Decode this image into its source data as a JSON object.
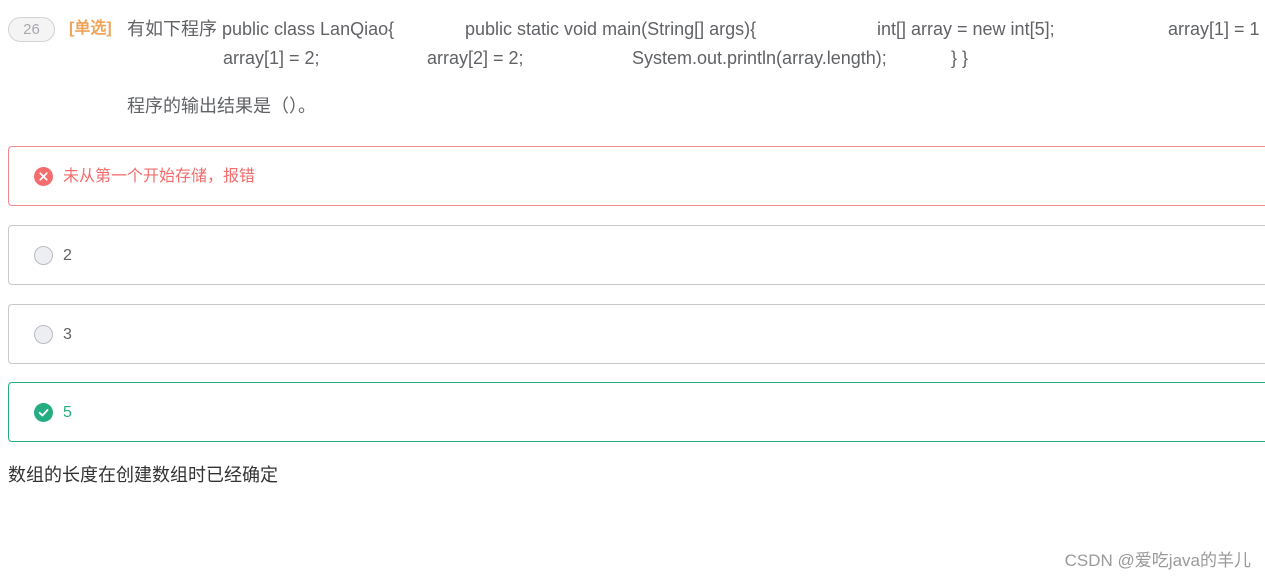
{
  "question": {
    "number": "26",
    "type_label": "[单选]",
    "code_lines": [
      {
        "text": "有如下程序 public class LanQiao{"
      },
      {
        "text": "public static void main(String[] args){"
      },
      {
        "text": "int[] array = new int[5];"
      },
      {
        "text": "array[1] = 1"
      },
      {
        "text": "array[1] = 2;"
      },
      {
        "text": "array[2] = 2;"
      },
      {
        "text": "System.out.println(array.length);"
      },
      {
        "text": "} }"
      }
    ],
    "prompt": "程序的输出结果是（）。"
  },
  "options": [
    {
      "label": "未从第一个开始存储，报错",
      "state": "wrong",
      "icon": "x-circle-icon"
    },
    {
      "label": "2",
      "state": "unselected",
      "icon": "radio-icon"
    },
    {
      "label": "3",
      "state": "unselected",
      "icon": "radio-icon"
    },
    {
      "label": "5",
      "state": "correct",
      "icon": "check-circle-icon"
    }
  ],
  "explanation": "数组的长度在创建数组时已经确定",
  "watermark": "CSDN @爱吃java的羊儿",
  "colors": {
    "wrong": "#f56c6c",
    "correct": "#23ad80",
    "type_label": "#f0a45a"
  }
}
